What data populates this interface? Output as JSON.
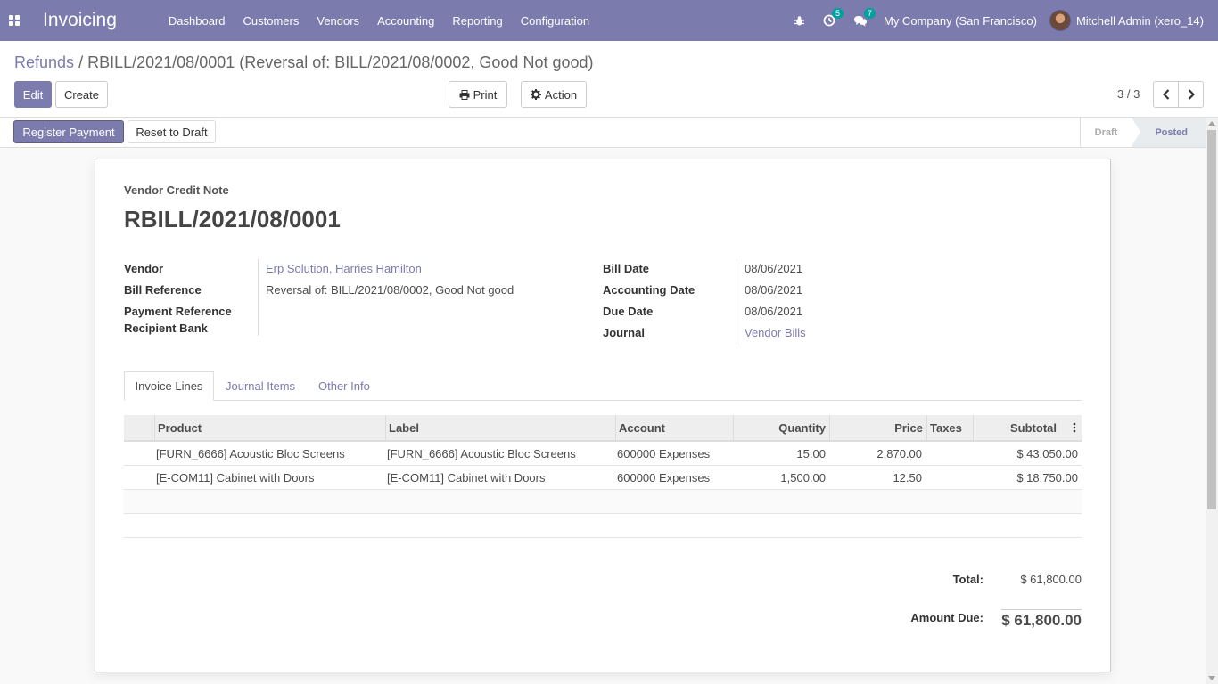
{
  "navbar": {
    "app_name": "Invoicing",
    "menu": [
      "Dashboard",
      "Customers",
      "Vendors",
      "Accounting",
      "Reporting",
      "Configuration"
    ],
    "activity_count": "5",
    "message_count": "7",
    "company": "My Company (San Francisco)",
    "user": "Mitchell Admin (xero_14)",
    "color": "#7c7bad"
  },
  "breadcrumb": {
    "parent": "Refunds",
    "separator": "/",
    "current": "RBILL/2021/08/0001 (Reversal of: BILL/2021/08/0002, Good Not good)"
  },
  "toolbar": {
    "edit_label": "Edit",
    "create_label": "Create",
    "print_label": "Print",
    "action_label": "Action",
    "pager": "3 / 3"
  },
  "statusbar": {
    "register_payment_label": "Register Payment",
    "reset_label": "Reset to Draft",
    "states": [
      "Draft",
      "Posted"
    ],
    "active_state": "Posted"
  },
  "sheet": {
    "doc_type": "Vendor Credit Note",
    "doc_name": "RBILL/2021/08/0001",
    "left_fields": {
      "vendor_label": "Vendor",
      "vendor_value": "Erp Solution, Harries Hamilton",
      "bill_ref_label": "Bill Reference",
      "bill_ref_value": "Reversal of: BILL/2021/08/0002, Good Not good",
      "payment_ref_label": "Payment Reference",
      "recipient_bank_label": "Recipient Bank"
    },
    "right_fields": {
      "bill_date_label": "Bill Date",
      "bill_date_value": "08/06/2021",
      "accounting_date_label": "Accounting Date",
      "accounting_date_value": "08/06/2021",
      "due_date_label": "Due Date",
      "due_date_value": "08/06/2021",
      "journal_label": "Journal",
      "journal_value": "Vendor Bills"
    },
    "tabs": [
      "Invoice Lines",
      "Journal Items",
      "Other Info"
    ],
    "columns": [
      "Product",
      "Label",
      "Account",
      "Quantity",
      "Price",
      "Taxes",
      "Subtotal"
    ],
    "lines": [
      {
        "product": "[FURN_6666] Acoustic Bloc Screens",
        "label": "[FURN_6666] Acoustic Bloc Screens",
        "account": "600000 Expenses",
        "quantity": "15.00",
        "price": "2,870.00",
        "taxes": "",
        "subtotal": "$ 43,050.00"
      },
      {
        "product": "[E-COM11] Cabinet with Doors",
        "label": "[E-COM11] Cabinet with Doors",
        "account": "600000 Expenses",
        "quantity": "1,500.00",
        "price": "12.50",
        "taxes": "",
        "subtotal": "$ 18,750.00"
      }
    ],
    "total_label": "Total:",
    "total_value": "$ 61,800.00",
    "amount_due_label": "Amount Due:",
    "amount_due_value": "$ 61,800.00"
  }
}
